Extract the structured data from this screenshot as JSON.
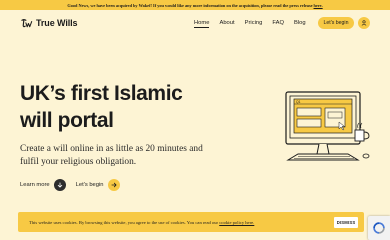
{
  "announcement": {
    "text": "Good News, we have been acquired by Wakef! If you would like any more information on the acquisition, please read the press release",
    "link_text": "here."
  },
  "nav": {
    "logo_text": "True Wills",
    "links": [
      "Home",
      "About",
      "Pricing",
      "FAQ",
      "Blog"
    ],
    "active": "Home",
    "cta_label": "Let's begin"
  },
  "hero": {
    "headline_line1": "UK’s first Islamic",
    "headline_line2": "will portal",
    "subline": "Create a will online in as little as 20 minutes and fulfil your religious obligation.",
    "learn_more": "Learn more",
    "lets_begin": "Let's begin"
  },
  "cookie": {
    "text": "This website uses cookies. By browsing this website, you agree to the use of cookies. You can read our",
    "link_text": "cookie policy here.",
    "dismiss_label": "DISMISS"
  },
  "icons": {
    "logo": "tw-logo-icon",
    "user": "user-icon",
    "learn_more": "arrow-down-icon",
    "lets_begin": "arrow-right-icon",
    "recaptcha": "recaptcha-icon"
  },
  "colors": {
    "background": "#fdf4d4",
    "accent": "#f7c944",
    "text": "#1c1c1c"
  }
}
